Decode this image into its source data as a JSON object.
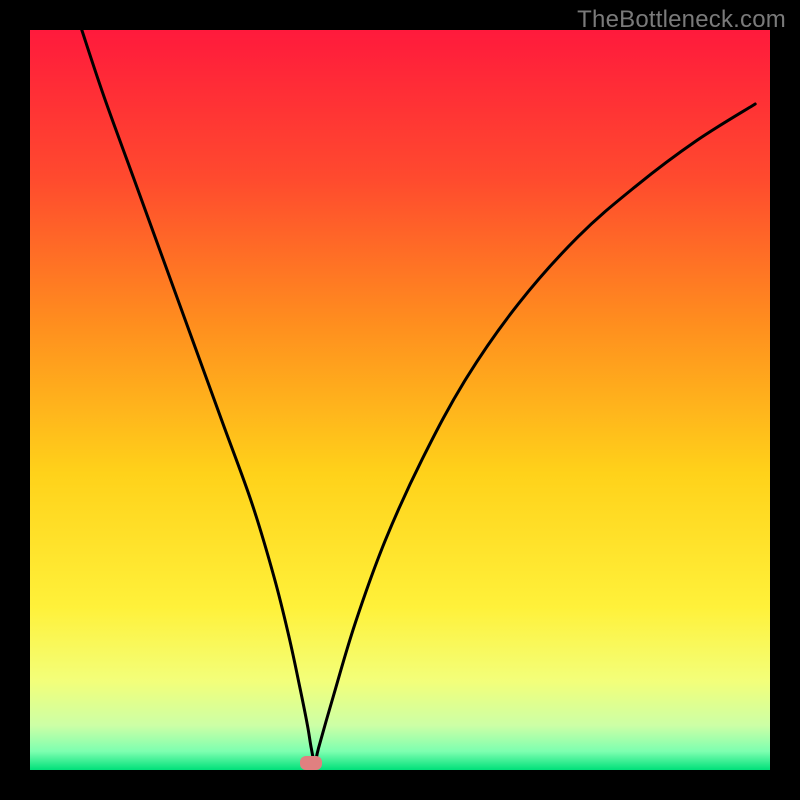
{
  "watermark": "TheBottleneck.com",
  "chart_data": {
    "type": "line",
    "title": "",
    "xlabel": "",
    "ylabel": "",
    "xlim": [
      0,
      100
    ],
    "ylim": [
      0,
      100
    ],
    "grid": false,
    "legend": false,
    "gradient_stops": [
      {
        "offset": 0.0,
        "color": "#ff1a3c"
      },
      {
        "offset": 0.2,
        "color": "#ff4a2e"
      },
      {
        "offset": 0.4,
        "color": "#ff8f1e"
      },
      {
        "offset": 0.6,
        "color": "#ffd21a"
      },
      {
        "offset": 0.78,
        "color": "#fff13a"
      },
      {
        "offset": 0.88,
        "color": "#f3ff7a"
      },
      {
        "offset": 0.94,
        "color": "#ccffa6"
      },
      {
        "offset": 0.975,
        "color": "#7dffb0"
      },
      {
        "offset": 1.0,
        "color": "#00e07a"
      }
    ],
    "series": [
      {
        "name": "bottleneck-curve",
        "x": [
          7,
          10,
          14,
          18,
          22,
          26,
          30,
          33,
          35,
          36.5,
          37.5,
          38,
          38.5,
          39,
          41,
          44,
          48,
          53,
          59,
          66,
          74,
          82,
          90,
          98
        ],
        "values": [
          100,
          91,
          80,
          69,
          58,
          47,
          36,
          26,
          18,
          11,
          6,
          3,
          1,
          3,
          10,
          20,
          31,
          42,
          53,
          63,
          72,
          79,
          85,
          90
        ]
      }
    ],
    "marker": {
      "x": 38,
      "y": 1,
      "color": "#e08080"
    }
  }
}
